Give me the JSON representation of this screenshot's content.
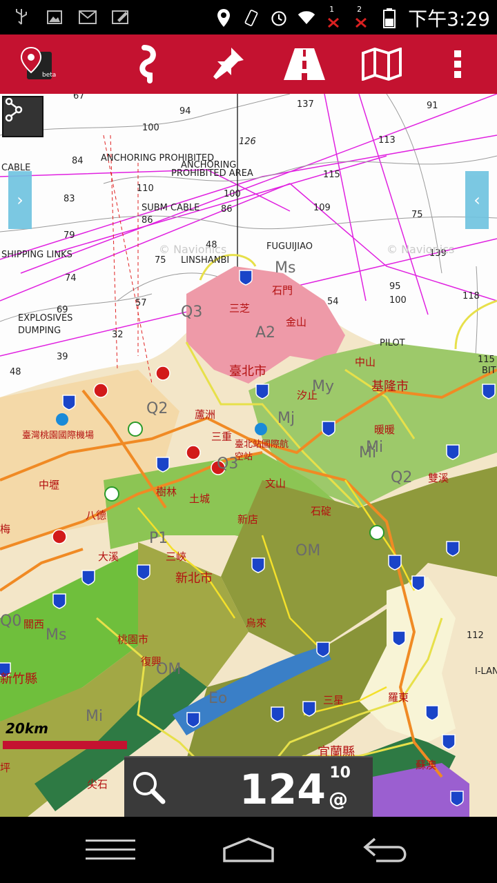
{
  "status_bar": {
    "time": "下午3:29",
    "sim1": "1",
    "sim2": "2",
    "icons": [
      "usb-icon",
      "image-icon",
      "gmail-icon",
      "edit-icon",
      "location-icon",
      "vibrate-icon",
      "alarm-icon",
      "wifi-icon",
      "signal1-icon",
      "signal2-icon",
      "battery-icon"
    ]
  },
  "app_bar": {
    "logo_text": "beta",
    "actions": [
      "route-icon",
      "pin-icon",
      "road-icon",
      "map-icon",
      "overflow-menu-icon"
    ],
    "accent": "#c41230"
  },
  "map": {
    "watermark": "© Navionics",
    "chart_labels": [
      "67",
      "94",
      "137",
      "91",
      "100",
      "126",
      "113",
      "CABLE",
      "84",
      "ANCHORING PROHIBITED",
      "ANCHORING",
      "PROHIBITED AREA",
      "115",
      "83",
      "110",
      "SUBM CABLE",
      "86",
      "100",
      "109",
      "75",
      "86",
      "79",
      "48",
      "FUGUIJIAO",
      "SHIPPING LINKS",
      "75",
      "LINSHANBI",
      "139",
      "74",
      "95",
      "100",
      "118",
      "57",
      "54",
      "69",
      "EXPLOSIVES",
      "DUMPING",
      "32",
      "39",
      "48",
      "PILOT",
      "115",
      "BIT",
      "112",
      "I-LAN"
    ],
    "place_labels": [
      "石門",
      "三芝",
      "金山",
      "臺北市",
      "中山",
      "基隆市",
      "汐止",
      "蘆洲",
      "暖暖",
      "臺灣桃園國際機場",
      "三重",
      "臺北站國際航空站",
      "雙溪",
      "中壢",
      "樹林",
      "土城",
      "文山",
      "八德",
      "新店",
      "石碇",
      "梅",
      "大溪",
      "三峽",
      "新北市",
      "關西",
      "桃園市",
      "烏來",
      "復興",
      "新竹縣",
      "三星",
      "羅東",
      "宜蘭縣",
      "蘇澳",
      "尖石",
      "坪"
    ],
    "geo_labels": [
      "Q3",
      "A2",
      "Ms",
      "Q2",
      "My",
      "Mj",
      "Mi",
      "Q3",
      "OM",
      "P1",
      "Ms",
      "OM",
      "Eo",
      "Mi",
      "Q2",
      "Mi",
      "Q0"
    ],
    "scale": "20km"
  },
  "zoom": {
    "value": "124",
    "sup": "10",
    "at": "@"
  },
  "nav_bar": {
    "buttons": [
      "recent-apps-icon",
      "home-icon",
      "back-icon"
    ]
  }
}
